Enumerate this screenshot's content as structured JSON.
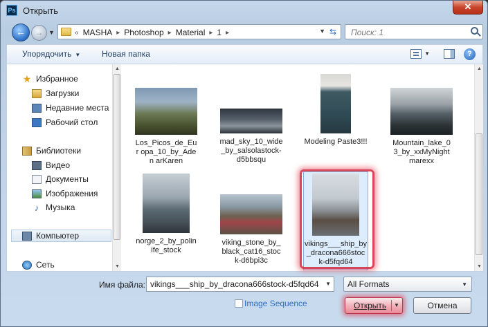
{
  "window": {
    "title": "Открыть",
    "app_icon_label": "Ps",
    "close_label": "✕"
  },
  "address_bar": {
    "crumbs": [
      "MASHA",
      "Photoshop",
      "Material",
      "1"
    ],
    "prefix": "«"
  },
  "search": {
    "placeholder": "Поиск: 1"
  },
  "toolbar": {
    "organize_label": "Упорядочить",
    "new_folder_label": "Новая папка",
    "help_label": "?"
  },
  "nav_pane": {
    "favorites": {
      "label": "Избранное",
      "items": [
        "Загрузки",
        "Недавние места",
        "Рабочий стол"
      ]
    },
    "libraries": {
      "label": "Библиотеки",
      "items": [
        "Видео",
        "Документы",
        "Изображения",
        "Музыка"
      ]
    },
    "computer": "Компьютер",
    "network": "Сеть"
  },
  "files": [
    {
      "name": "Los_Picos_de_Europa_10_by_AdenarKaren",
      "label": "Los_Picos_de_Eur opa_10_by_Aden arKaren"
    },
    {
      "name": "mad_sky_10_wide_by_salsolastock-d5bbsqu",
      "label": "mad_sky_10_wide _by_salsolastock- d5bbsqu"
    },
    {
      "name": "Modeling Paste3!!!",
      "label": "Modeling Paste3!!!"
    },
    {
      "name": "Mountain_lake_03_by_xxMyNightmarexx",
      "label": "Mountain_lake_0 3_by_xxMyNight marexx"
    },
    {
      "name": "norge_2_by_polinife_stock",
      "label": "norge_2_by_polin ife_stock"
    },
    {
      "name": "viking_stone_by_black_cat16_stock-d6bpi3c",
      "label": "viking_stone_by_ black_cat16_stoc k-d6bpi3c"
    },
    {
      "name": "vikings___ship_by_dracona666stock-d5fqd64",
      "label": "vikings___ship_by _dracona666stoc k-d5fqd64",
      "selected": true
    }
  ],
  "footer": {
    "filename_label": "Имя файла:",
    "filename_value": "vikings___ship_by_dracona666stock-d5fqd64",
    "format_value": "All Formats",
    "image_sequence_label": "Image Sequence",
    "image_sequence_checked": false,
    "open_label": "Открыть",
    "cancel_label": "Отмена"
  },
  "colors": {
    "highlight": "#d2283c",
    "link_blue": "#2d6fc6"
  }
}
